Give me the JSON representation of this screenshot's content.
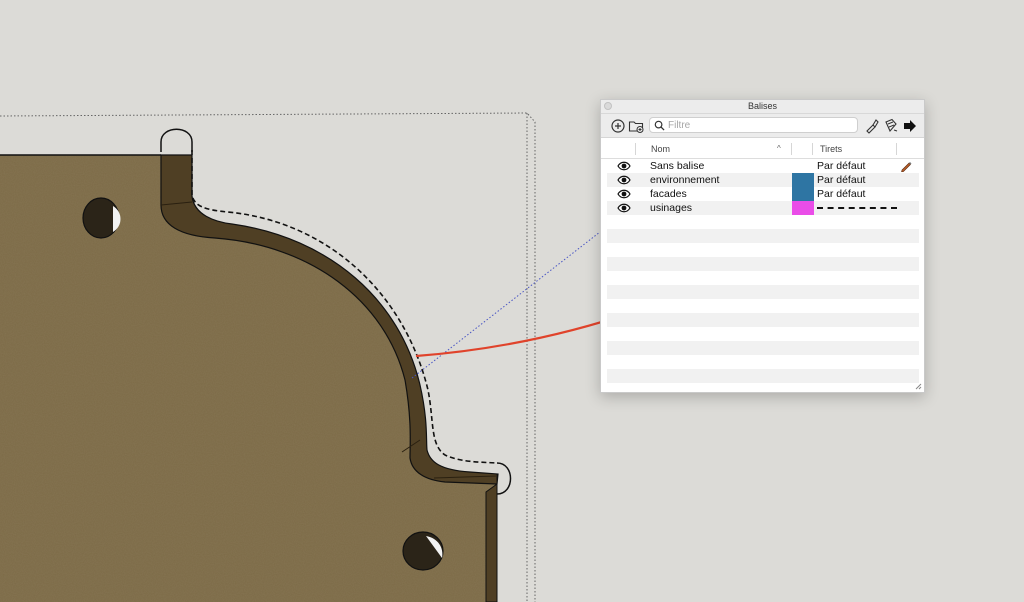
{
  "window": {
    "title": "Balises"
  },
  "toolbar": {
    "filter_placeholder": "Filtre",
    "icons": [
      "add-tag-icon",
      "add-folder-icon",
      "search-icon",
      "paint-icon",
      "color-by-tag-icon",
      "details-arrow-icon"
    ]
  },
  "table": {
    "headers": {
      "name": "Nom",
      "dashes": "Tirets",
      "sort": "^"
    },
    "rows": [
      {
        "name": "Sans balise",
        "visible": true,
        "color": null,
        "dashes": "Par défaut",
        "active": true
      },
      {
        "name": "environnement",
        "visible": true,
        "color": "#2e75a3",
        "dashes": "Par défaut",
        "active": false
      },
      {
        "name": "facades",
        "visible": true,
        "color": "#2e75a3",
        "dashes": "Par défaut",
        "active": false
      },
      {
        "name": "usinages",
        "visible": true,
        "color": "#ea4de8",
        "dashes": "dashed",
        "active": false
      }
    ]
  },
  "colors": {
    "board": "#7b6845",
    "board_edge": "#4e3e23",
    "annotation_arrow": "#e0432b",
    "background": "#dcdbd7"
  }
}
